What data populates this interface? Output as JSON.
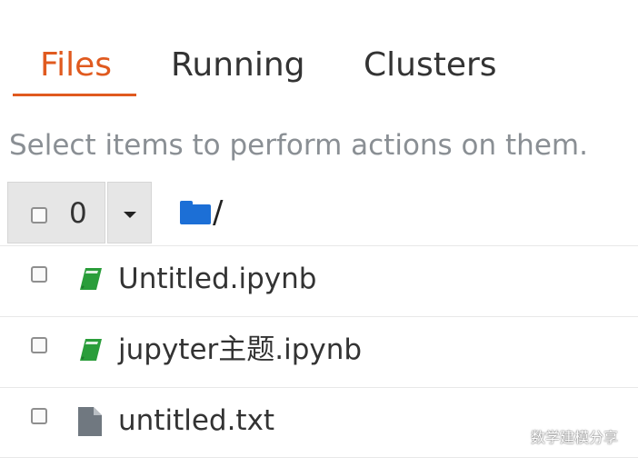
{
  "tabs": [
    {
      "label": "Files",
      "active": true
    },
    {
      "label": "Running",
      "active": false
    },
    {
      "label": "Clusters",
      "active": false
    }
  ],
  "hint": "Select items to perform actions on them.",
  "toolbar": {
    "selected_count": "0",
    "breadcrumb": "/"
  },
  "files": [
    {
      "name": "Untitled.ipynb",
      "type": "notebook",
      "icon": "notebook-icon"
    },
    {
      "name": "jupyter主题.ipynb",
      "type": "notebook",
      "icon": "notebook-icon"
    },
    {
      "name": "untitled.txt",
      "type": "file",
      "icon": "file-icon"
    }
  ],
  "watermark": "数学建模分享",
  "colors": {
    "accent": "#e05a1f",
    "folder": "#1c6fd6",
    "notebook": "#2a9d3a",
    "file": "#707880",
    "hint_text": "#8a8f94"
  }
}
